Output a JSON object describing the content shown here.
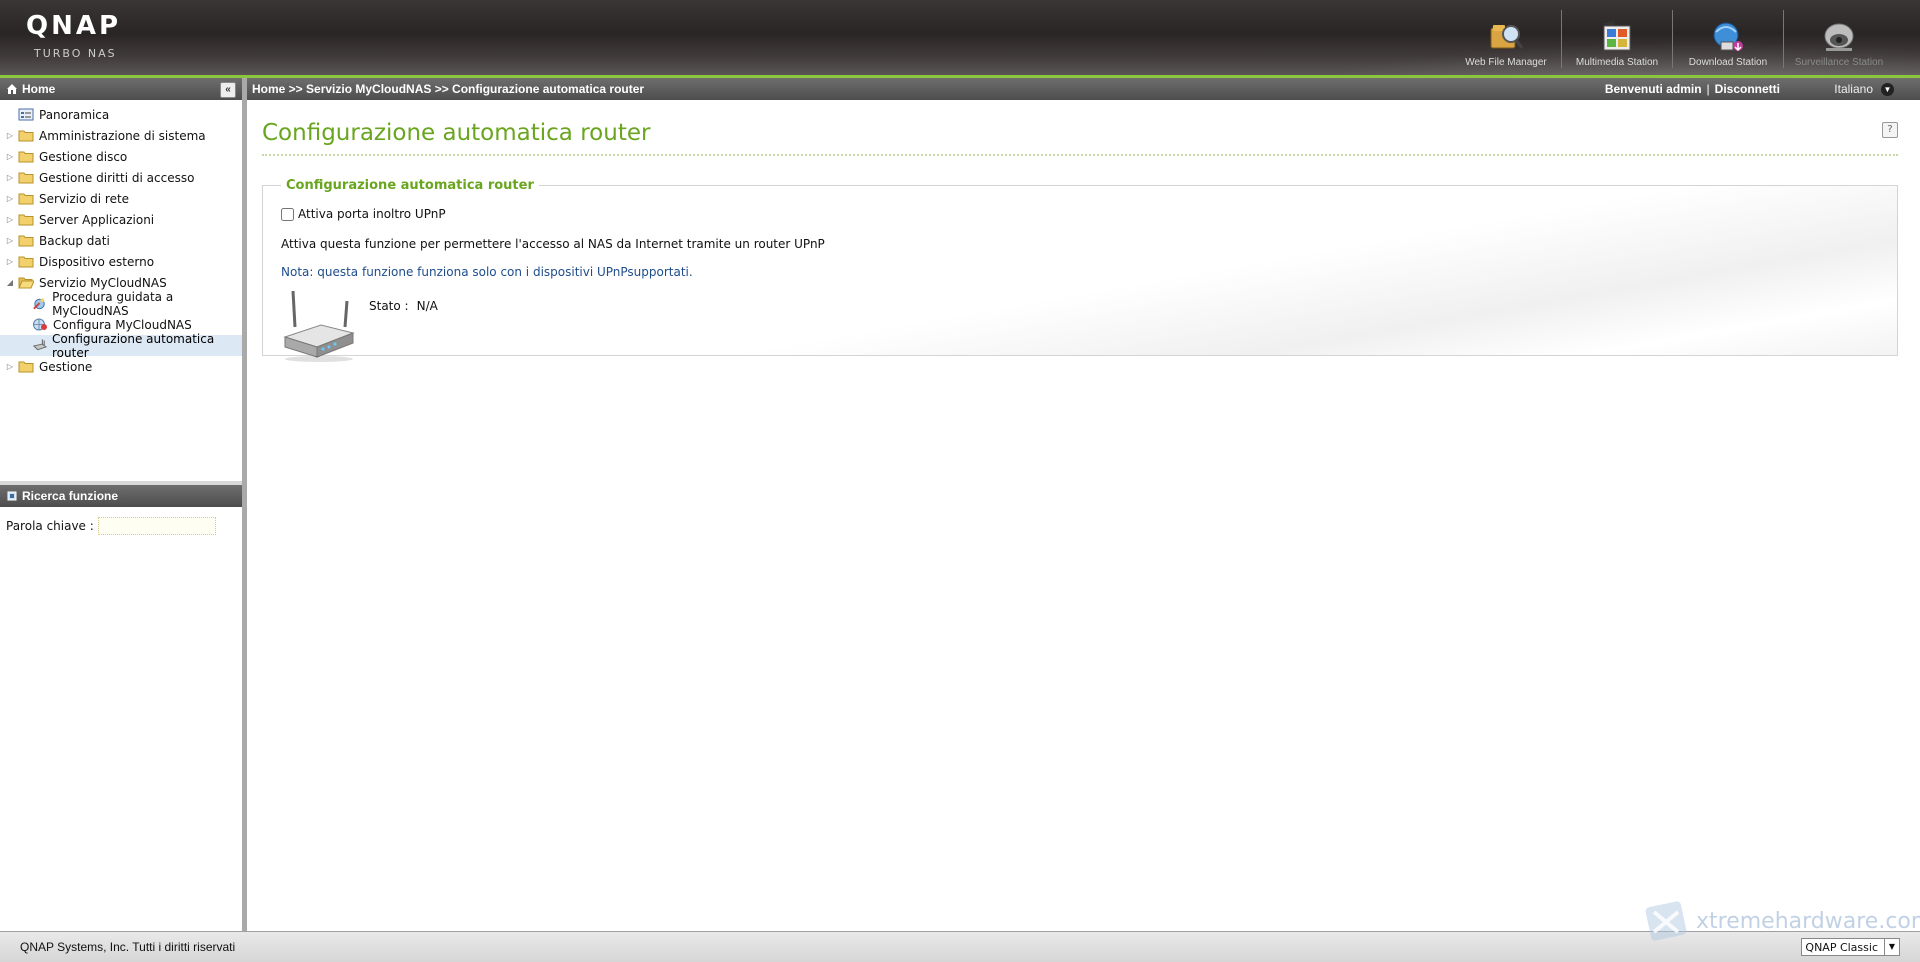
{
  "header": {
    "brand": "QNAP",
    "subtitle": "TURBO NAS",
    "stations": [
      {
        "label": "Web File Manager",
        "icon": "web-file-manager-icon"
      },
      {
        "label": "Multimedia Station",
        "icon": "multimedia-station-icon"
      },
      {
        "label": "Download Station",
        "icon": "download-station-icon"
      },
      {
        "label": "Surveillance Station",
        "icon": "surveillance-station-icon"
      }
    ]
  },
  "sidebar": {
    "title": "Home",
    "tree": [
      {
        "label": "Panoramica"
      },
      {
        "label": "Amministrazione di sistema"
      },
      {
        "label": "Gestione disco"
      },
      {
        "label": "Gestione diritti di accesso"
      },
      {
        "label": "Servizio di rete"
      },
      {
        "label": "Server Applicazioni"
      },
      {
        "label": "Backup dati"
      },
      {
        "label": "Dispositivo esterno"
      },
      {
        "label": "Servizio MyCloudNAS"
      },
      {
        "label": "Procedura guidata a MyCloudNAS"
      },
      {
        "label": "Configura MyCloudNAS"
      },
      {
        "label": "Configurazione automatica router"
      },
      {
        "label": "Gestione"
      }
    ],
    "search": {
      "title": "Ricerca funzione",
      "keyword_label": "Parola chiave :",
      "keyword_value": ""
    }
  },
  "topbar": {
    "breadcrumb": "Home >> Servizio MyCloudNAS >> Configurazione automatica router",
    "welcome": "Benvenuti admin",
    "sep": "|",
    "logout": "Disconnetti",
    "language": "Italiano"
  },
  "main": {
    "title": "Configurazione automatica router",
    "help": "?",
    "panel": {
      "legend": "Configurazione automatica router",
      "checkbox_label": "Attiva porta inoltro UPnP",
      "checkbox_checked": false,
      "description": "Attiva questa funzione per permettere l'accesso al NAS da Internet tramite un router UPnP",
      "note": "Nota: questa funzione funziona solo con i dispositivi UPnPsupportati.",
      "status_label": "Stato :",
      "status_value": "N/A"
    }
  },
  "footer": {
    "copyright": "QNAP Systems, Inc. Tutti i diritti riservati",
    "theme": "QNAP Classic",
    "watermark": "xtremehardware.com"
  },
  "colors": {
    "accent_green": "#69a51e",
    "header_dark": "#2a2525",
    "note_blue": "#1e4d8c"
  }
}
